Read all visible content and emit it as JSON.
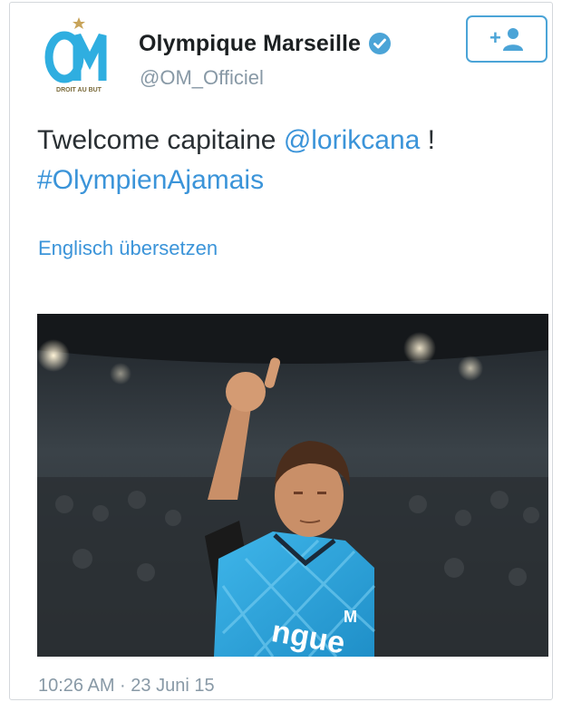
{
  "account": {
    "display_name": "Olympique Marseille",
    "handle": "@OM_Officiel",
    "verified": true,
    "avatar_icon": "om-club-crest",
    "crest_text": "DROIT AU BUT"
  },
  "follow_button": {
    "icon": "follow-user-icon",
    "label": "+"
  },
  "tweet": {
    "text_prefix": "Twelcome capitaine ",
    "mention": "@lorikcana",
    "text_suffix": " !",
    "hashtag": "#OlympienAjamais"
  },
  "translate_link": "Englisch übersetzen",
  "photo": {
    "description_icon": "player-thumbs-up-photo",
    "jersey_text": "ngue"
  },
  "timestamp": "10:26 AM · 23 Juni 15",
  "colors": {
    "link": "#3b94d9",
    "om_blue": "#2faee0",
    "text": "#292f33",
    "muted": "#8899a6"
  }
}
